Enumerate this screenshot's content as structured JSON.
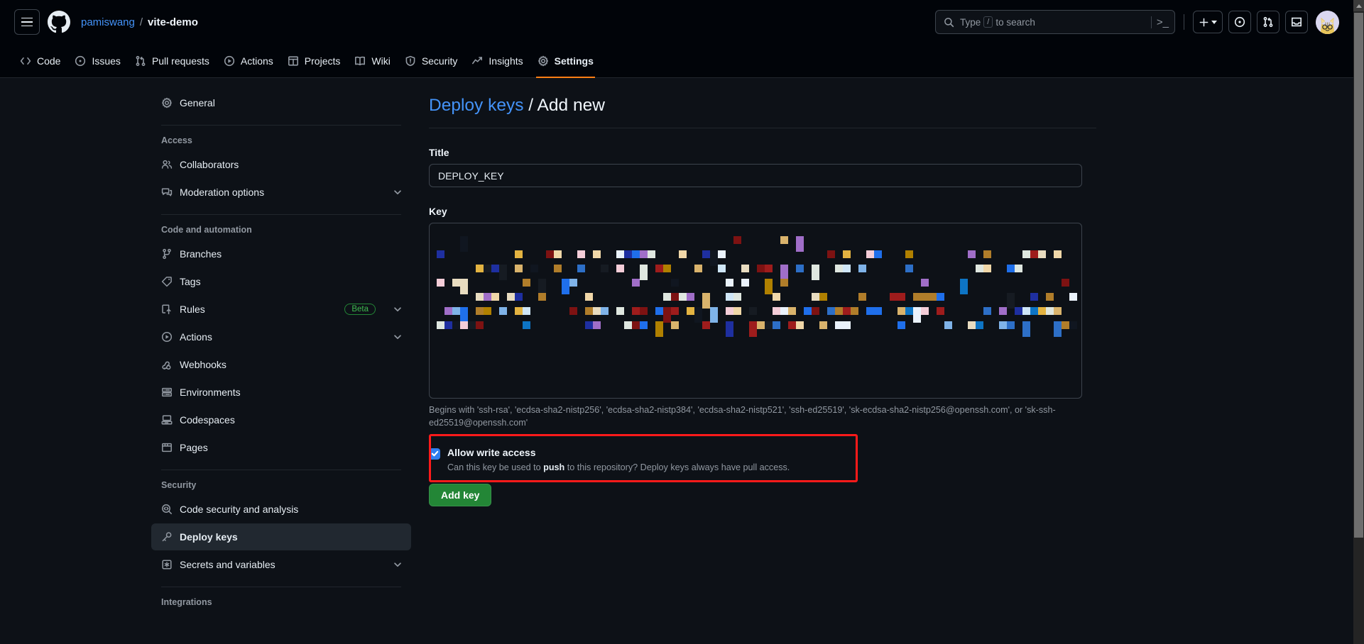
{
  "header": {
    "hamburger": "menu-toggle",
    "logo": "github-logo",
    "owner": "pamiswang",
    "separator": "/",
    "repo": "vite-demo",
    "search_placeholder_prefix": "Type",
    "search_slash_key": "/",
    "search_placeholder_suffix": "to search",
    "command_palette": ">_",
    "create_new_label": "+",
    "issues_icon": "issue-opened-icon",
    "pull_requests_icon": "git-pull-request-icon",
    "inbox_icon": "inbox-icon",
    "avatar_label": "user-avatar"
  },
  "repo_nav": {
    "tabs": [
      {
        "label": "Code",
        "icon": "code-icon",
        "active": false
      },
      {
        "label": "Issues",
        "icon": "issue-opened-icon",
        "active": false
      },
      {
        "label": "Pull requests",
        "icon": "git-pull-request-icon",
        "active": false
      },
      {
        "label": "Actions",
        "icon": "play-icon",
        "active": false
      },
      {
        "label": "Projects",
        "icon": "table-icon",
        "active": false
      },
      {
        "label": "Wiki",
        "icon": "book-icon",
        "active": false
      },
      {
        "label": "Security",
        "icon": "shield-icon",
        "active": false
      },
      {
        "label": "Insights",
        "icon": "graph-icon",
        "active": false
      },
      {
        "label": "Settings",
        "icon": "gear-icon",
        "active": true
      }
    ]
  },
  "sidebar": {
    "general": {
      "label": "General",
      "icon": "gear-icon"
    },
    "groups": [
      {
        "title": "Access",
        "items": [
          {
            "label": "Collaborators",
            "icon": "people-icon",
            "chevron": false,
            "badge": null
          },
          {
            "label": "Moderation options",
            "icon": "comment-discussion-icon",
            "chevron": true,
            "badge": null
          }
        ]
      },
      {
        "title": "Code and automation",
        "items": [
          {
            "label": "Branches",
            "icon": "git-branch-icon",
            "chevron": false,
            "badge": null
          },
          {
            "label": "Tags",
            "icon": "tag-icon",
            "chevron": false,
            "badge": null
          },
          {
            "label": "Rules",
            "icon": "rules-icon",
            "chevron": true,
            "badge": "Beta"
          },
          {
            "label": "Actions",
            "icon": "play-icon",
            "chevron": true,
            "badge": null
          },
          {
            "label": "Webhooks",
            "icon": "webhook-icon",
            "chevron": false,
            "badge": null
          },
          {
            "label": "Environments",
            "icon": "server-icon",
            "chevron": false,
            "badge": null
          },
          {
            "label": "Codespaces",
            "icon": "codespaces-icon",
            "chevron": false,
            "badge": null
          },
          {
            "label": "Pages",
            "icon": "browser-icon",
            "chevron": false,
            "badge": null
          }
        ]
      },
      {
        "title": "Security",
        "items": [
          {
            "label": "Code security and analysis",
            "icon": "codescan-icon",
            "chevron": false,
            "badge": null
          },
          {
            "label": "Deploy keys",
            "icon": "key-icon",
            "chevron": false,
            "badge": null,
            "selected": true
          },
          {
            "label": "Secrets and variables",
            "icon": "asterisk-icon",
            "chevron": true,
            "badge": null
          }
        ]
      },
      {
        "title": "Integrations",
        "items": []
      }
    ]
  },
  "main": {
    "breadcrumb_link": "Deploy keys",
    "breadcrumb_sep": "/",
    "breadcrumb_current": "Add new",
    "title_label": "Title",
    "title_value": "DEPLOY_KEY",
    "title_placeholder": "",
    "key_label": "Key",
    "key_value_redacted": "ssh-key-content-redacted",
    "key_placeholder": "",
    "help_text": "Begins with 'ssh-rsa', 'ecdsa-sha2-nistp256', 'ecdsa-sha2-nistp384', 'ecdsa-sha2-nistp521', 'ssh-ed25519', 'sk-ecdsa-sha2-nistp256@openssh.com', or 'sk-ssh-ed25519@openssh.com'",
    "allow_write_label": "Allow write access",
    "allow_write_checked": true,
    "allow_write_desc_pre": "Can this key be used to ",
    "allow_write_desc_bold": "push",
    "allow_write_desc_post": " to this repository? Deploy keys always have pull access.",
    "submit_label": "Add key"
  },
  "colors": {
    "page_bg": "#0d1117",
    "header_bg": "#010409",
    "accent_link": "#4493f8",
    "selected_bar": "#316dca",
    "beta_green": "#3fb950",
    "button_green": "#238636",
    "highlight_red": "#ff1a1a",
    "checkbox_blue": "#2f7ef0"
  },
  "scrollbar": {
    "name": "page-scrollbar",
    "up_arrow": "scroll-up-arrow"
  }
}
